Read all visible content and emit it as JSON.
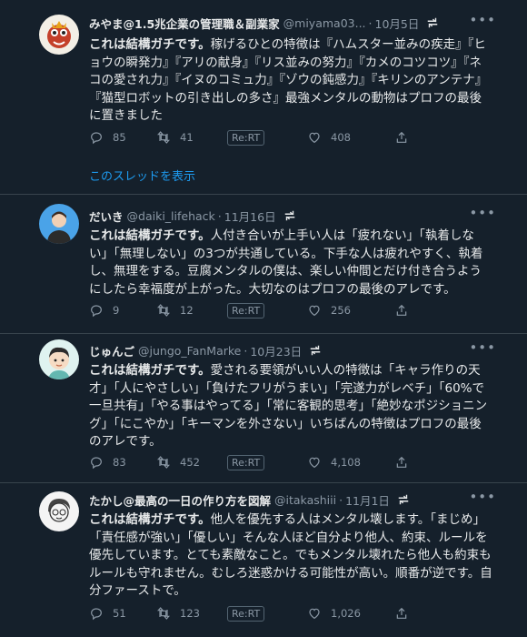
{
  "tweets": [
    {
      "name": "みやま@1.5兆企業の管理職＆副業家",
      "handle": "@miyama03...",
      "date": "10月5日",
      "text_bold": "これは結構ガチです。",
      "text_rest": "稼げるひとの特徴は『ハムスター並みの疾走』『ヒョウの瞬発力』『アリの献身』『リス並みの努力』『カメのコツコツ』『ネコの愛され力』『イヌのコミュ力』『ゾウの鈍感力』『キリンのアンテナ』『猫型ロボットの引き出しの多さ』最強メンタルの動物はプロフの最後に置きました",
      "replies": "85",
      "retweets": "41",
      "rert": "Re:RT",
      "likes": "408",
      "thread_link": "このスレッドを表示"
    },
    {
      "name": "だいき",
      "handle": "@daiki_lifehack",
      "date": "11月16日",
      "text_bold": "これは結構ガチです。",
      "text_rest": "人付き合いが上手い人は「疲れない」「執着しない」「無理しない」の3つが共通している。下手な人は疲れやすく、執着し、無理をする。豆腐メンタルの僕は、楽しい仲間とだけ付き合うようにしたら幸福度が上がった。大切なのはプロフの最後のアレです。",
      "replies": "9",
      "retweets": "12",
      "rert": "Re:RT",
      "likes": "256"
    },
    {
      "name": "じゅんご",
      "handle": "@jungo_FanMarke",
      "date": "10月23日",
      "text_bold": "これは結構ガチです。",
      "text_rest": "愛される要領がいい人の特徴は「キャラ作りの天才」「人にやさしい」「負けたフリがうまい」「完遂力がレベチ」「60%で一旦共有」「やる事はやってる」「常に客観的思考」「絶妙なポジショニング」「にこやか」「キーマンを外さない」いちばんの特徴はプロフの最後のアレです。",
      "replies": "83",
      "retweets": "452",
      "rert": "Re:RT",
      "likes": "4,108"
    },
    {
      "name": "たかし@最高の一日の作り方を図解",
      "handle": "@itakashiii",
      "date": "11月1日",
      "text_bold": "これは結構ガチです。",
      "text_rest": "他人を優先する人はメンタル壊します。「まじめ」「責任感が強い」「優しい」そんな人ほど自分より他人、約束、ルールを優先しています。とても素敵なこと。でもメンタル壊れたら他人も約束もルールも守れません。むしろ迷惑かける可能性が高い。順番が逆です。自分ファーストで。",
      "replies": "51",
      "retweets": "123",
      "rert": "Re:RT",
      "likes": "1,026"
    }
  ],
  "colors": {
    "background": "#15202b",
    "text": "#e7e9ea",
    "muted": "#8b98a5",
    "accent": "#1d9bf0",
    "divider": "#38444d"
  },
  "icons": [
    "reply-icon",
    "retweet-icon",
    "like-icon",
    "share-icon",
    "promote-icon",
    "more-icon"
  ]
}
